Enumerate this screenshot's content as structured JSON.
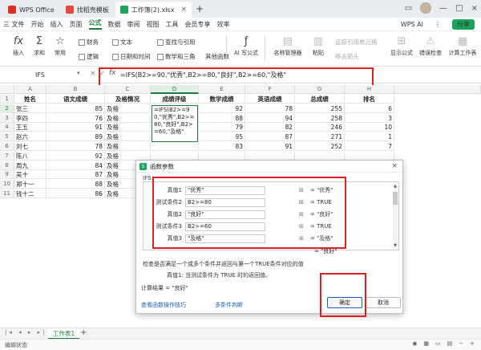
{
  "tabs": [
    {
      "label": "WPS Office",
      "icon_color": "#d93025"
    },
    {
      "label": "找稻壳模板",
      "icon_color": "#e8453c"
    },
    {
      "label": "工作簿(2).xlsx",
      "icon_color": "#1aa35b",
      "active": true
    }
  ],
  "menu": [
    "三 文件",
    "开始",
    "插入",
    "页面",
    "公式",
    "数据",
    "审阅",
    "视图",
    "工具",
    "会员专享",
    "效率"
  ],
  "menu_active": "公式",
  "wps_ai": "WPS AI",
  "share": "分享",
  "ribbon": {
    "insert": "插入",
    "sum": "求和",
    "common": "常用",
    "finance": "财务",
    "logic": "逻辑",
    "text": "文本",
    "datetime": "日期和时间",
    "lookup": "查找与引用",
    "mathtrig": "数学和三角",
    "other": "其他函数",
    "ai_formula": "AI 写公式",
    "name_mgr": "名称管理器",
    "paste": "粘贴",
    "trace": "追踪引用单元格",
    "remove": "移去箭头",
    "show": "显示公式",
    "error": "错误检查",
    "calc": "计算工作表"
  },
  "formula_bar": {
    "name_box": "IFS",
    "formula": "=IFS(B2>=90,\"优秀\",B2>=80,\"良好\",B2>=60,\"及格\""
  },
  "columns": [
    "A",
    "B",
    "C",
    "D",
    "E",
    "F",
    "G",
    "H"
  ],
  "sheet": {
    "headers": [
      "姓名",
      "语文成绩",
      "及格情况",
      "成绩评级",
      "数学成绩",
      "英语成绩",
      "总成绩",
      "排名"
    ],
    "rows": [
      [
        "张三",
        "85",
        "及格",
        "",
        "92",
        "78",
        "255",
        "6"
      ],
      [
        "李四",
        "76",
        "及格",
        "",
        "88",
        "94",
        "258",
        "3"
      ],
      [
        "王五",
        "91",
        "及格",
        "",
        "79",
        "82",
        "246",
        "10"
      ],
      [
        "赵六",
        "89",
        "及格",
        "",
        "95",
        "87",
        "271",
        "1"
      ],
      [
        "刘七",
        "78",
        "及格",
        "",
        "83",
        "91",
        "252",
        "7"
      ],
      [
        "陈八",
        "92",
        "及格",
        "",
        "",
        "",
        "",
        ""
      ],
      [
        "周九",
        "84",
        "及格",
        "",
        "",
        "",
        "",
        ""
      ],
      [
        "吴十",
        "87",
        "及格",
        "",
        "",
        "",
        "",
        ""
      ],
      [
        "郑十一",
        "88",
        "及格",
        "",
        "",
        "",
        "",
        ""
      ],
      [
        "钱十二",
        "86",
        "及格",
        "",
        "",
        "",
        "",
        ""
      ]
    ]
  },
  "edit_cell_text": "=IFS(B2>=90,\"优秀\",B2>=80,\"良好\",B2>=60,\"及格\"",
  "dialog": {
    "title": "函数参数",
    "fn_name": "IFS",
    "args": [
      {
        "label": "真值1",
        "value": "\"优秀\"",
        "result": "= \"优秀\""
      },
      {
        "label": "测试条件2",
        "value": "B2>=80",
        "result": "= TRUE"
      },
      {
        "label": "真值2",
        "value": "\"良好\"",
        "result": "= \"良好\""
      },
      {
        "label": "测试条件3",
        "value": "B2>=60",
        "result": "= TRUE"
      },
      {
        "label": "真值3",
        "value": "\"及格\"",
        "result": "= \"及格\""
      }
    ],
    "extra_result": "= \"良好\"",
    "description": "检查是否满足一个或多个条件并返回与第一个TRUE条件对应的值",
    "arg_desc": "真值1:  当测试条件为 TRUE 时的返回值。",
    "calc_result": "计算结果 = \"良好\"",
    "link1": "查看函数操作技巧",
    "link2": "多条件判断",
    "ok": "确定",
    "cancel": "取消"
  },
  "sheet_tab": "工作表1",
  "status": "编辑状态"
}
